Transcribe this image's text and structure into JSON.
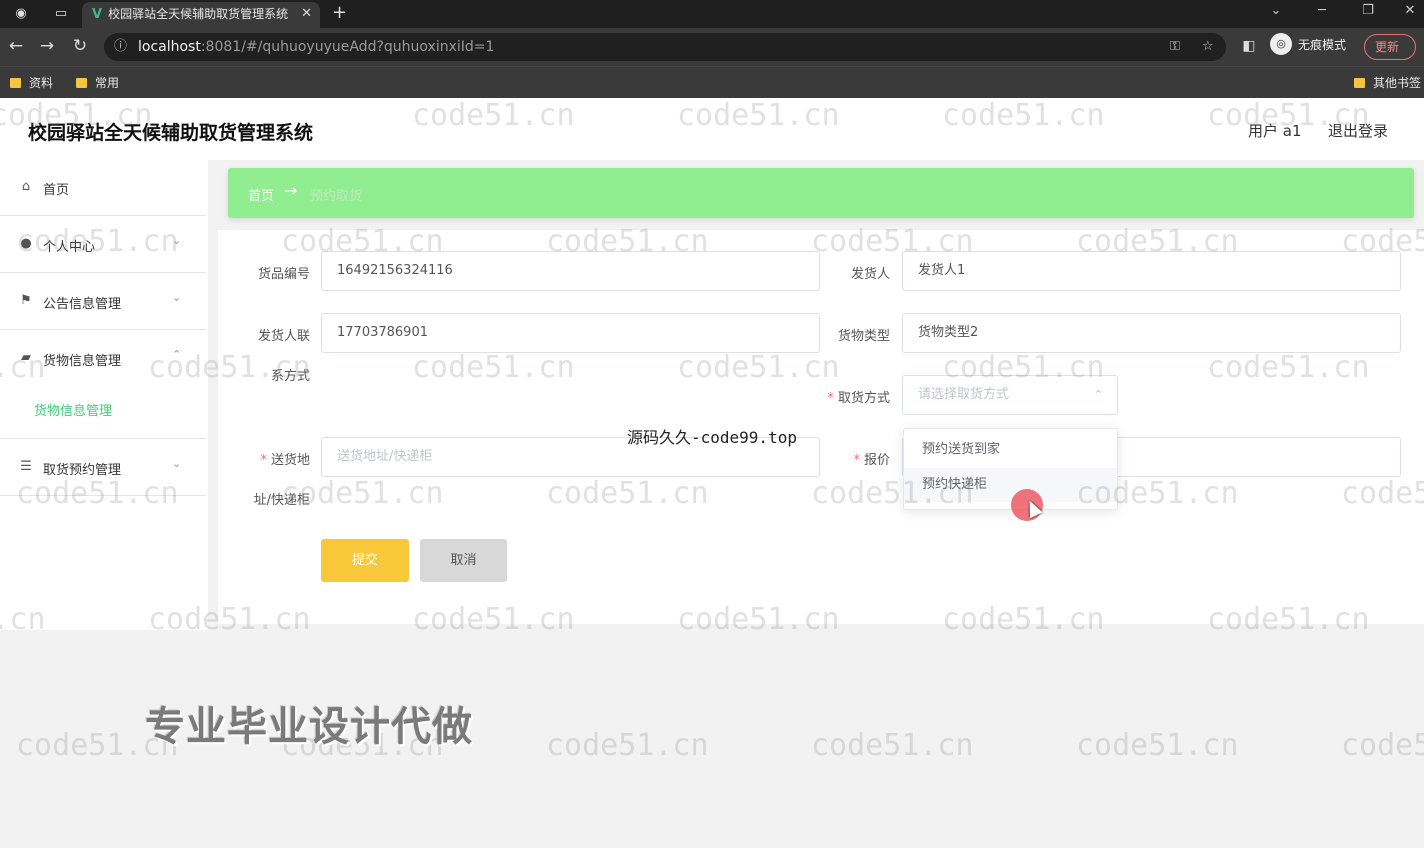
{
  "browser": {
    "tab_title": "校园驿站全天候辅助取货管理系统",
    "url_host": "localhost",
    "url_rest": ":8081/#/quhuoyuyueAdd?quhuoxinxiId=1",
    "incognito_label": "无痕模式",
    "update_label": "更新",
    "bookmarks": [
      "资料",
      "常用"
    ],
    "other_bookmarks": "其他书签"
  },
  "header": {
    "title": "校园驿站全天候辅助取货管理系统",
    "user_label": "用户 a1",
    "logout_label": "退出登录"
  },
  "sidebar": {
    "items": [
      {
        "label": "首页",
        "icon": "home-icon"
      },
      {
        "label": "个人中心",
        "icon": "user-icon"
      },
      {
        "label": "公告信息管理",
        "icon": "flag-icon"
      },
      {
        "label": "货物信息管理",
        "icon": "truck-icon"
      },
      {
        "label": "取货预约管理",
        "icon": "list-icon"
      }
    ],
    "active_sub": "货物信息管理"
  },
  "breadcrumb": {
    "home": "首页",
    "current": "预约取货"
  },
  "form": {
    "goods_no_label": "货品编号",
    "goods_no_value": "16492156324116",
    "sender_label": "发货人",
    "sender_value": "发货人1",
    "sender_phone_label_1": "发货人联",
    "sender_phone_label_2": "系方式",
    "sender_phone_value": "17703786901",
    "goods_type_label": "货物类型",
    "goods_type_value": "货物类型2",
    "pickup_method_label": "取货方式",
    "pickup_method_placeholder": "请选择取货方式",
    "address_label_1": "送货地",
    "address_label_2": "址/快递柜",
    "address_placeholder": "送货地址/快递柜",
    "price_label": "报价",
    "options": [
      "预约送货到家",
      "预约快递柜"
    ],
    "submit_label": "提交",
    "cancel_label": "取消"
  },
  "overlays": {
    "watermark": "code51.cn",
    "center_text": "源码久久-code99.top",
    "promo": "专业毕业设计代做"
  }
}
